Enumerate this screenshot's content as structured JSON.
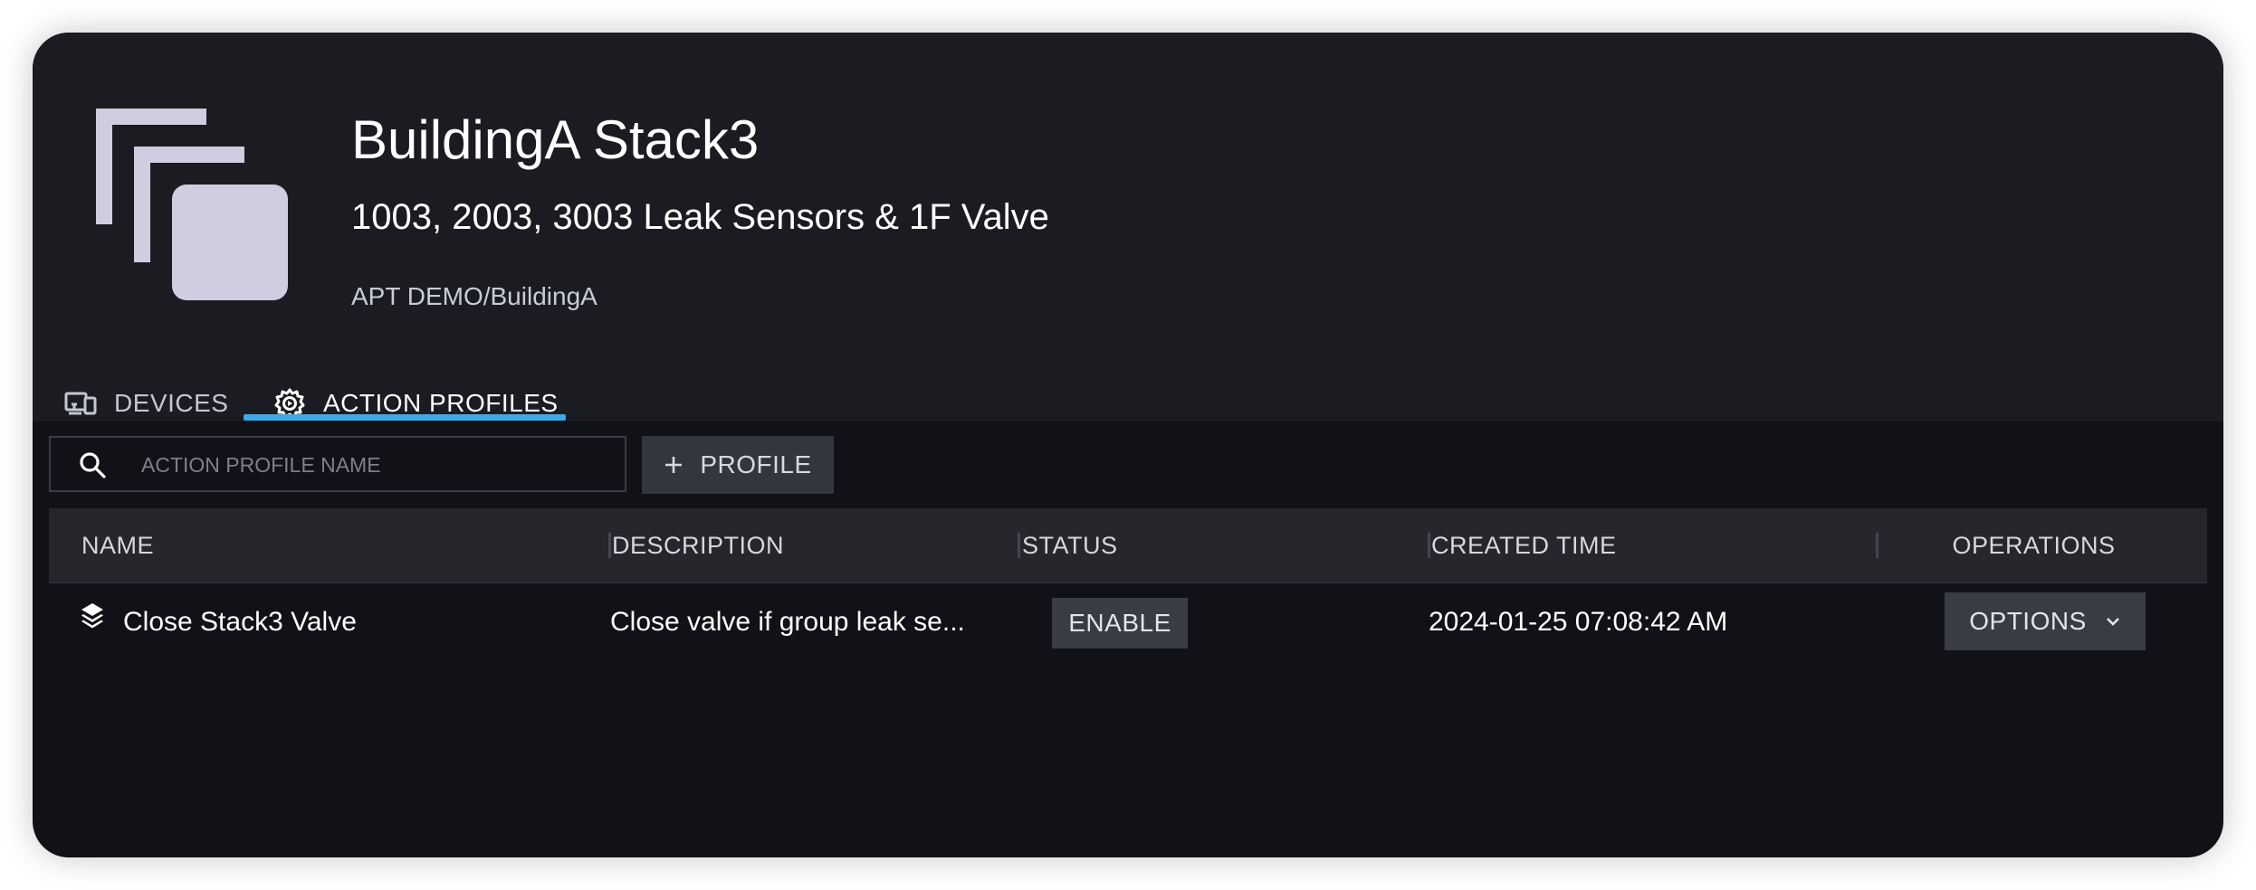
{
  "header": {
    "title": "BuildingA Stack3",
    "subtitle": "1003, 2003, 3003 Leak Sensors & 1F Valve",
    "path": "APT DEMO/BuildingA",
    "icon": "group-stack-icon",
    "icon_color": "#cfcde0"
  },
  "tabs": [
    {
      "label": "DEVICES",
      "icon": "devices-icon",
      "active": false
    },
    {
      "label": "ACTION PROFILES",
      "icon": "action-gear-icon",
      "active": true
    }
  ],
  "accent_color": "#3fa9e6",
  "toolbar": {
    "search_placeholder": "ACTION PROFILE NAME",
    "search_value": "",
    "add_label": "PROFILE",
    "add_icon": "plus-icon"
  },
  "table": {
    "columns": [
      "NAME",
      "DESCRIPTION",
      "STATUS",
      "CREATED TIME",
      "OPERATIONS"
    ],
    "rows": [
      {
        "icon": "layers-icon",
        "name": "Close Stack3 Valve",
        "description": "Close valve if group leak se...",
        "status": "ENABLE",
        "created_time": "2024-01-25 07:08:42 AM",
        "operations": "OPTIONS"
      }
    ]
  }
}
